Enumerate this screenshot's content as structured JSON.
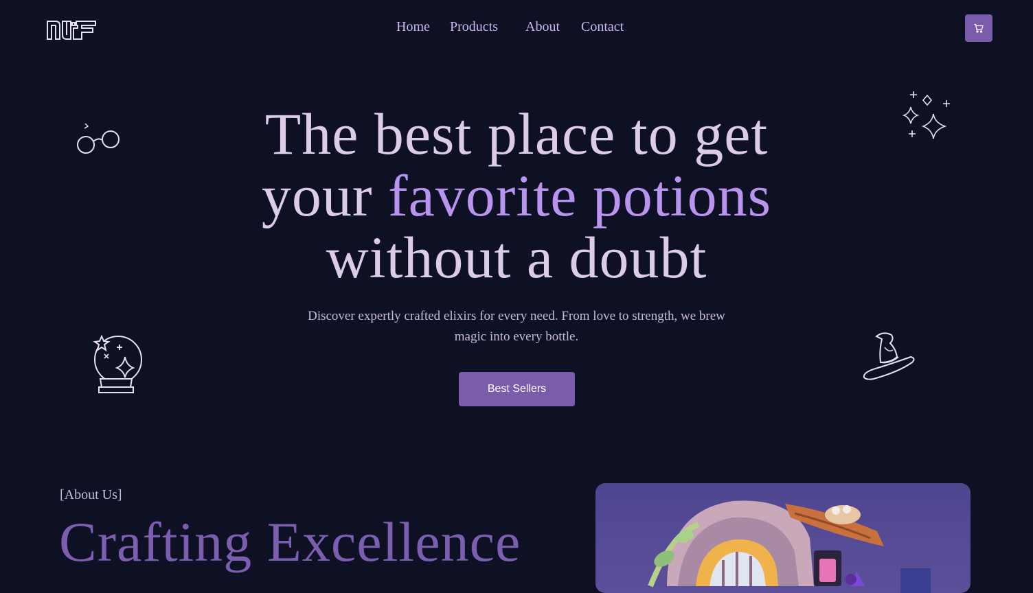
{
  "brand": {
    "logo_text": "NF"
  },
  "nav": {
    "items": [
      {
        "label": "Home"
      },
      {
        "label": "Products"
      },
      {
        "label": "About"
      },
      {
        "label": "Contact"
      }
    ]
  },
  "header": {
    "cart_icon": "cart-icon",
    "cart_color": "#7b5cab"
  },
  "hero": {
    "title_line1": "The best place to get",
    "title_line2_a": "your",
    "title_line2_highlight": "favorite potions",
    "title_line3": "without a doubt",
    "subtitle": "Discover expertly crafted elixirs for every need. From love to strength, we brew magic into every bottle.",
    "cta_label": "Best Sellers",
    "decor_icons": [
      "glasses-icon",
      "sparkles-icon",
      "crystal-ball-icon",
      "wizard-hat-icon"
    ]
  },
  "about": {
    "tag": "[About Us]",
    "heading": "Crafting Excellence"
  },
  "colors": {
    "background": "#0e1024",
    "accent": "#7b5cab",
    "highlight": "#b894ee",
    "title": "#dccbe9"
  }
}
